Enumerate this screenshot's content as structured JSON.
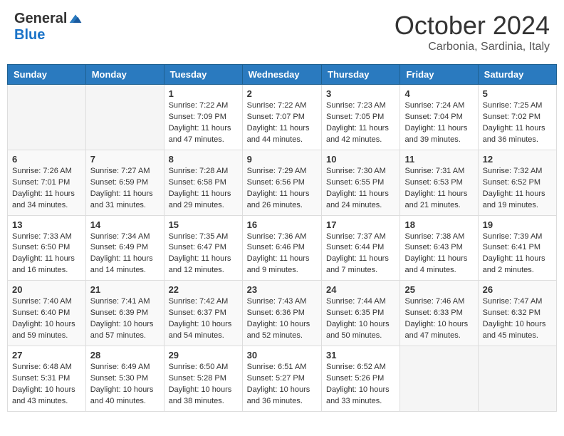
{
  "header": {
    "logo_general": "General",
    "logo_blue": "Blue",
    "month_title": "October 2024",
    "subtitle": "Carbonia, Sardinia, Italy"
  },
  "weekdays": [
    "Sunday",
    "Monday",
    "Tuesday",
    "Wednesday",
    "Thursday",
    "Friday",
    "Saturday"
  ],
  "weeks": [
    [
      {
        "day": "",
        "sunrise": "",
        "sunset": "",
        "daylight": ""
      },
      {
        "day": "",
        "sunrise": "",
        "sunset": "",
        "daylight": ""
      },
      {
        "day": "1",
        "sunrise": "Sunrise: 7:22 AM",
        "sunset": "Sunset: 7:09 PM",
        "daylight": "Daylight: 11 hours and 47 minutes."
      },
      {
        "day": "2",
        "sunrise": "Sunrise: 7:22 AM",
        "sunset": "Sunset: 7:07 PM",
        "daylight": "Daylight: 11 hours and 44 minutes."
      },
      {
        "day": "3",
        "sunrise": "Sunrise: 7:23 AM",
        "sunset": "Sunset: 7:05 PM",
        "daylight": "Daylight: 11 hours and 42 minutes."
      },
      {
        "day": "4",
        "sunrise": "Sunrise: 7:24 AM",
        "sunset": "Sunset: 7:04 PM",
        "daylight": "Daylight: 11 hours and 39 minutes."
      },
      {
        "day": "5",
        "sunrise": "Sunrise: 7:25 AM",
        "sunset": "Sunset: 7:02 PM",
        "daylight": "Daylight: 11 hours and 36 minutes."
      }
    ],
    [
      {
        "day": "6",
        "sunrise": "Sunrise: 7:26 AM",
        "sunset": "Sunset: 7:01 PM",
        "daylight": "Daylight: 11 hours and 34 minutes."
      },
      {
        "day": "7",
        "sunrise": "Sunrise: 7:27 AM",
        "sunset": "Sunset: 6:59 PM",
        "daylight": "Daylight: 11 hours and 31 minutes."
      },
      {
        "day": "8",
        "sunrise": "Sunrise: 7:28 AM",
        "sunset": "Sunset: 6:58 PM",
        "daylight": "Daylight: 11 hours and 29 minutes."
      },
      {
        "day": "9",
        "sunrise": "Sunrise: 7:29 AM",
        "sunset": "Sunset: 6:56 PM",
        "daylight": "Daylight: 11 hours and 26 minutes."
      },
      {
        "day": "10",
        "sunrise": "Sunrise: 7:30 AM",
        "sunset": "Sunset: 6:55 PM",
        "daylight": "Daylight: 11 hours and 24 minutes."
      },
      {
        "day": "11",
        "sunrise": "Sunrise: 7:31 AM",
        "sunset": "Sunset: 6:53 PM",
        "daylight": "Daylight: 11 hours and 21 minutes."
      },
      {
        "day": "12",
        "sunrise": "Sunrise: 7:32 AM",
        "sunset": "Sunset: 6:52 PM",
        "daylight": "Daylight: 11 hours and 19 minutes."
      }
    ],
    [
      {
        "day": "13",
        "sunrise": "Sunrise: 7:33 AM",
        "sunset": "Sunset: 6:50 PM",
        "daylight": "Daylight: 11 hours and 16 minutes."
      },
      {
        "day": "14",
        "sunrise": "Sunrise: 7:34 AM",
        "sunset": "Sunset: 6:49 PM",
        "daylight": "Daylight: 11 hours and 14 minutes."
      },
      {
        "day": "15",
        "sunrise": "Sunrise: 7:35 AM",
        "sunset": "Sunset: 6:47 PM",
        "daylight": "Daylight: 11 hours and 12 minutes."
      },
      {
        "day": "16",
        "sunrise": "Sunrise: 7:36 AM",
        "sunset": "Sunset: 6:46 PM",
        "daylight": "Daylight: 11 hours and 9 minutes."
      },
      {
        "day": "17",
        "sunrise": "Sunrise: 7:37 AM",
        "sunset": "Sunset: 6:44 PM",
        "daylight": "Daylight: 11 hours and 7 minutes."
      },
      {
        "day": "18",
        "sunrise": "Sunrise: 7:38 AM",
        "sunset": "Sunset: 6:43 PM",
        "daylight": "Daylight: 11 hours and 4 minutes."
      },
      {
        "day": "19",
        "sunrise": "Sunrise: 7:39 AM",
        "sunset": "Sunset: 6:41 PM",
        "daylight": "Daylight: 11 hours and 2 minutes."
      }
    ],
    [
      {
        "day": "20",
        "sunrise": "Sunrise: 7:40 AM",
        "sunset": "Sunset: 6:40 PM",
        "daylight": "Daylight: 10 hours and 59 minutes."
      },
      {
        "day": "21",
        "sunrise": "Sunrise: 7:41 AM",
        "sunset": "Sunset: 6:39 PM",
        "daylight": "Daylight: 10 hours and 57 minutes."
      },
      {
        "day": "22",
        "sunrise": "Sunrise: 7:42 AM",
        "sunset": "Sunset: 6:37 PM",
        "daylight": "Daylight: 10 hours and 54 minutes."
      },
      {
        "day": "23",
        "sunrise": "Sunrise: 7:43 AM",
        "sunset": "Sunset: 6:36 PM",
        "daylight": "Daylight: 10 hours and 52 minutes."
      },
      {
        "day": "24",
        "sunrise": "Sunrise: 7:44 AM",
        "sunset": "Sunset: 6:35 PM",
        "daylight": "Daylight: 10 hours and 50 minutes."
      },
      {
        "day": "25",
        "sunrise": "Sunrise: 7:46 AM",
        "sunset": "Sunset: 6:33 PM",
        "daylight": "Daylight: 10 hours and 47 minutes."
      },
      {
        "day": "26",
        "sunrise": "Sunrise: 7:47 AM",
        "sunset": "Sunset: 6:32 PM",
        "daylight": "Daylight: 10 hours and 45 minutes."
      }
    ],
    [
      {
        "day": "27",
        "sunrise": "Sunrise: 6:48 AM",
        "sunset": "Sunset: 5:31 PM",
        "daylight": "Daylight: 10 hours and 43 minutes."
      },
      {
        "day": "28",
        "sunrise": "Sunrise: 6:49 AM",
        "sunset": "Sunset: 5:30 PM",
        "daylight": "Daylight: 10 hours and 40 minutes."
      },
      {
        "day": "29",
        "sunrise": "Sunrise: 6:50 AM",
        "sunset": "Sunset: 5:28 PM",
        "daylight": "Daylight: 10 hours and 38 minutes."
      },
      {
        "day": "30",
        "sunrise": "Sunrise: 6:51 AM",
        "sunset": "Sunset: 5:27 PM",
        "daylight": "Daylight: 10 hours and 36 minutes."
      },
      {
        "day": "31",
        "sunrise": "Sunrise: 6:52 AM",
        "sunset": "Sunset: 5:26 PM",
        "daylight": "Daylight: 10 hours and 33 minutes."
      },
      {
        "day": "",
        "sunrise": "",
        "sunset": "",
        "daylight": ""
      },
      {
        "day": "",
        "sunrise": "",
        "sunset": "",
        "daylight": ""
      }
    ]
  ]
}
